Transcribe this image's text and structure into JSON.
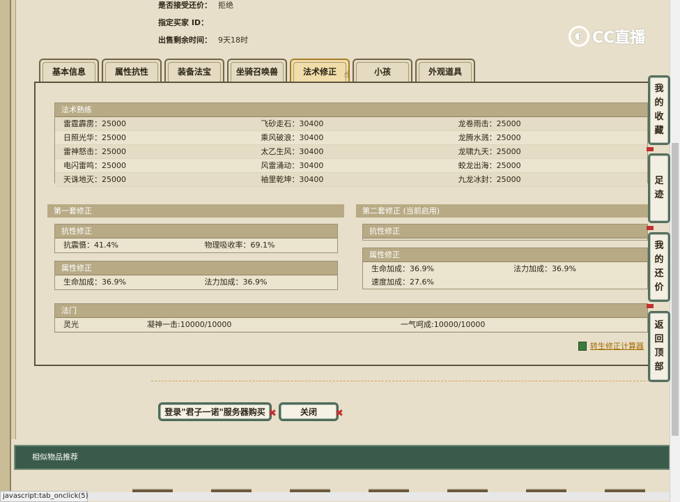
{
  "top_info": [
    {
      "label": "是否接受还价：",
      "value": "拒绝"
    },
    {
      "label": "指定买家 ID：",
      "value": ""
    },
    {
      "label": "出售剩余时间：",
      "value": "9天18时"
    }
  ],
  "logo_text": "CC直播",
  "tabs": [
    "基本信息",
    "属性抗性",
    "装备法宝",
    "坐骑召唤兽",
    "法术修正",
    "小孩",
    "外观道具"
  ],
  "active_tab": "法术修正",
  "spell_mastery": {
    "title": "法术熟练",
    "rows": [
      [
        "雷霆霹雳：25000",
        "飞砂走石：30400",
        "龙卷雨击：25000"
      ],
      [
        "日照光华：25000",
        "乘风破浪：30400",
        "龙腾水溅：25000"
      ],
      [
        "雷神怒击：25000",
        "太乙生风：30400",
        "龙啸九天：25000"
      ],
      [
        "电闪雷鸣：25000",
        "风雷涌动：30400",
        "蛟龙出海：25000"
      ],
      [
        "天诛地灭：25000",
        "袖里乾坤：30400",
        "九龙冰封：25000"
      ]
    ]
  },
  "set1": {
    "title": "第一套修正",
    "resist": {
      "title": "抗性修正",
      "items": [
        "抗震慑：41.4%",
        "物理吸收率：69.1%"
      ]
    },
    "attr": {
      "title": "属性修正",
      "items": [
        "生命加成：36.9%",
        "法力加成：36.9%"
      ]
    }
  },
  "set2": {
    "title": "第二套修正 (当前启用)",
    "resist": {
      "title": "抗性修正"
    },
    "attr": {
      "title": "属性修正",
      "items": [
        "生命加成：36.9%",
        "法力加成：36.9%",
        "速度加成：27.6%"
      ]
    }
  },
  "fa_men": {
    "title": "法门",
    "items": [
      "灵光",
      "凝神一击:10000/10000",
      "一气呵成:10000/10000"
    ]
  },
  "calc_link": "转生修正计算器",
  "buttons": {
    "login_buy": "登录\"君子一诺\"服务器购买",
    "close": "关闭"
  },
  "similar_title": "相似物品推荐",
  "status_text": "javascript:tab_onclick(5);",
  "side_menu": [
    {
      "label": "我的收藏",
      "chars": [
        "我",
        "的",
        "收",
        "藏"
      ]
    },
    {
      "label": "足迹",
      "chars": [
        "足",
        "迹"
      ]
    },
    {
      "label": "我的还价",
      "chars": [
        "我",
        "的",
        "还",
        "价"
      ]
    },
    {
      "label": "返回顶部",
      "chars": [
        "返",
        "回",
        "顶",
        "部"
      ]
    }
  ],
  "colors": {
    "accent": "#b8aa85",
    "link": "#a56a00",
    "dark_green": "#3a5a4a"
  }
}
